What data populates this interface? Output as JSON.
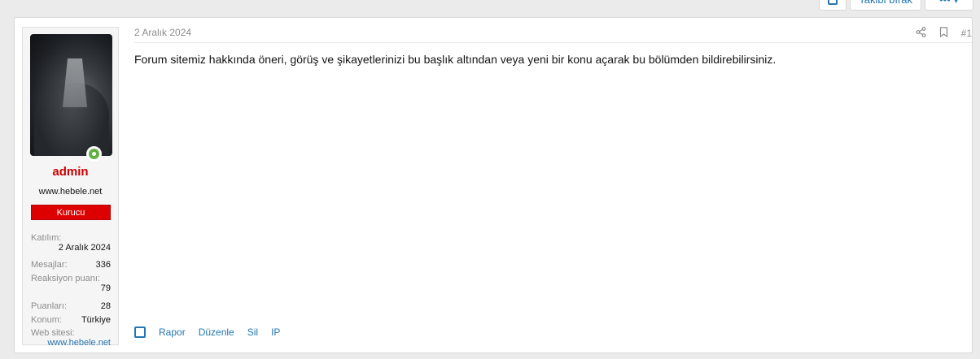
{
  "top_buttons": {
    "follow_label": "Takibi bırak",
    "more_label": "••• ▾"
  },
  "post": {
    "date": "2 Aralık 2024",
    "number": "#1",
    "body": "Forum sitemiz hakkında öneri, görüş ve şikayetlerinizi bu başlık altından veya yeni bir konu açarak bu bölümden bildirebilirsiniz.",
    "actions": [
      "Rapor",
      "Düzenle",
      "Sil",
      "IP"
    ]
  },
  "user": {
    "name": "admin",
    "title": "www.hebele.net",
    "banner": "Kurucu",
    "stats": {
      "joined_label": "Katılım:",
      "joined_value": "2 Aralık 2024",
      "messages_label": "Mesajlar:",
      "messages_value": "336",
      "reaction_label": "Reaksiyon puanı:",
      "reaction_value": "79",
      "points_label": "Puanları:",
      "points_value": "28",
      "location_label": "Konum:",
      "location_value": "Türkiye",
      "website_label": "Web sitesi:",
      "website_value": "www.hebele.net"
    }
  },
  "icons": {
    "share": "share-icon",
    "bookmark": "bookmark-icon",
    "online": "online-status-icon"
  },
  "colors": {
    "username": "#cc0000",
    "banner": "#dd0000",
    "link": "#2577b1",
    "online": "#63b144"
  }
}
